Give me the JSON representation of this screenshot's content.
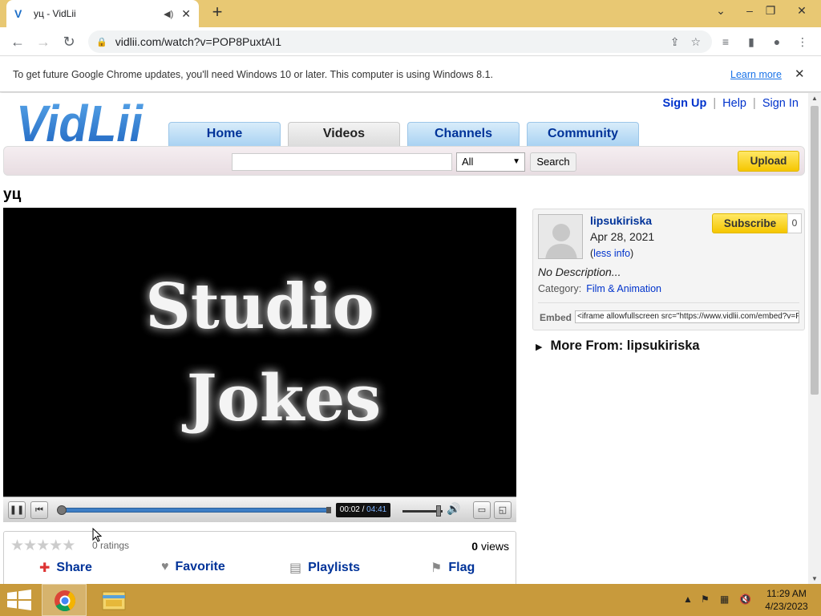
{
  "browser": {
    "tab_title": "уц - VidLii",
    "tab_favicon": "V",
    "url": "vidlii.com/watch?v=POP8PuxtAI1",
    "infobar_message": "To get future Google Chrome updates, you'll need Windows 10 or later. This computer is using Windows 8.1.",
    "infobar_link": "Learn more"
  },
  "site": {
    "logo_text": "VidLii",
    "topnav": {
      "signup": "Sign Up",
      "help": "Help",
      "signin": "Sign In",
      "separator": "|"
    },
    "tabs": [
      {
        "label": "Home"
      },
      {
        "label": "Videos"
      },
      {
        "label": "Channels"
      },
      {
        "label": "Community"
      }
    ],
    "search": {
      "value": "",
      "select_value": "All",
      "button": "Search"
    },
    "upload_button": "Upload"
  },
  "video": {
    "title": "уц",
    "frame_text_line1": "Studio",
    "frame_text_line2": "Jokes",
    "time_current": "00:02",
    "time_separator": " / ",
    "time_total": "04:41",
    "progress_fraction": 0.007
  },
  "stats": {
    "ratings_count": "0",
    "ratings_label": " ratings",
    "views_count": "0",
    "views_label": " views",
    "actions": [
      {
        "label": "Share",
        "icon": "share-icon"
      },
      {
        "label": "Favorite",
        "icon": "heart-icon"
      },
      {
        "label": "Playlists",
        "icon": "playlist-icon"
      },
      {
        "label": "Flag",
        "icon": "flag-icon"
      }
    ]
  },
  "uploader_panel": {
    "username": "lipsukiriska",
    "date": "Apr 28, 2021",
    "less_info_open": "(",
    "less_info_link": "less info",
    "less_info_close": ")",
    "subscribe": "Subscribe",
    "subscriber_count": "0",
    "description": "No Description...",
    "category_label": "Category:",
    "category_value": "Film & Animation",
    "embed_label": "Embed",
    "embed_code": "<iframe allowfullscreen src=\"https://www.vidlii.com/embed?v=P"
  },
  "more_from": "More From: lipsukiriska",
  "taskbar": {
    "time": "11:29 AM",
    "date": "4/23/2023"
  },
  "colors": {
    "titlebar": "#e8c873",
    "taskbar": "#c89a3c",
    "link_blue": "#003399",
    "button_yellow": "#f5c600"
  }
}
